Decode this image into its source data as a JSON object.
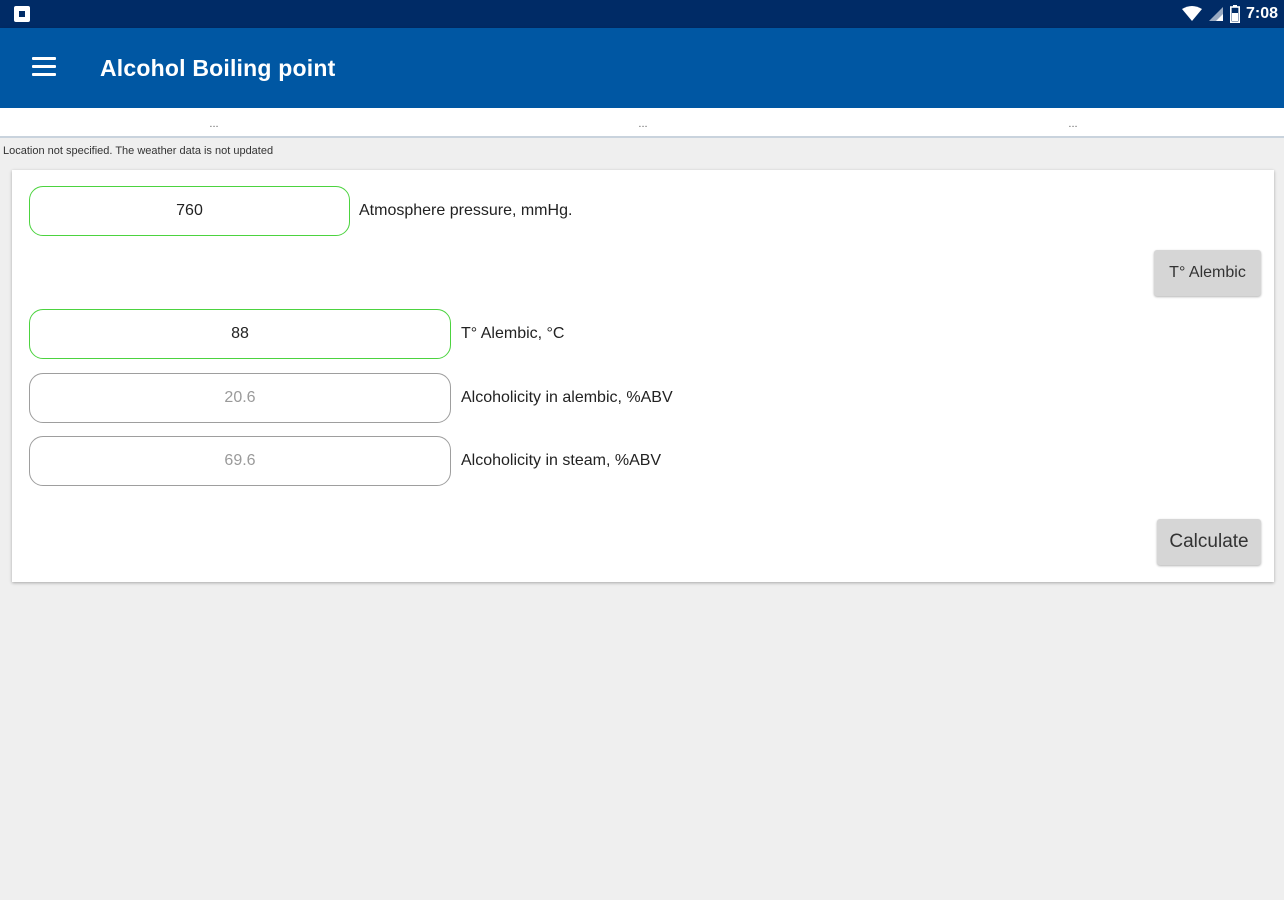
{
  "status_bar": {
    "time": "7:08"
  },
  "app_bar": {
    "title": "Alcohol Boiling point"
  },
  "weather_strip": {
    "cells": [
      "...",
      "...",
      "..."
    ]
  },
  "location_note": "Location not specified. The weather data is not updated",
  "form": {
    "pressure": {
      "value": "760",
      "label": "Atmosphere pressure, mmHg."
    },
    "t_alembic_button": "T° Alembic",
    "t_alembic": {
      "value": "88",
      "label": "T° Alembic, °C"
    },
    "alcoholicity_alembic": {
      "value": "20.6",
      "label": "Alcoholicity in alembic, %ABV"
    },
    "alcoholicity_steam": {
      "value": "69.6",
      "label": "Alcoholicity in steam, %ABV"
    },
    "calculate_button": "Calculate"
  },
  "colors": {
    "status_bar": "#002b66",
    "app_bar": "#0057a3",
    "active_border": "#4cd33f",
    "button_bg": "#d6d6d6"
  }
}
